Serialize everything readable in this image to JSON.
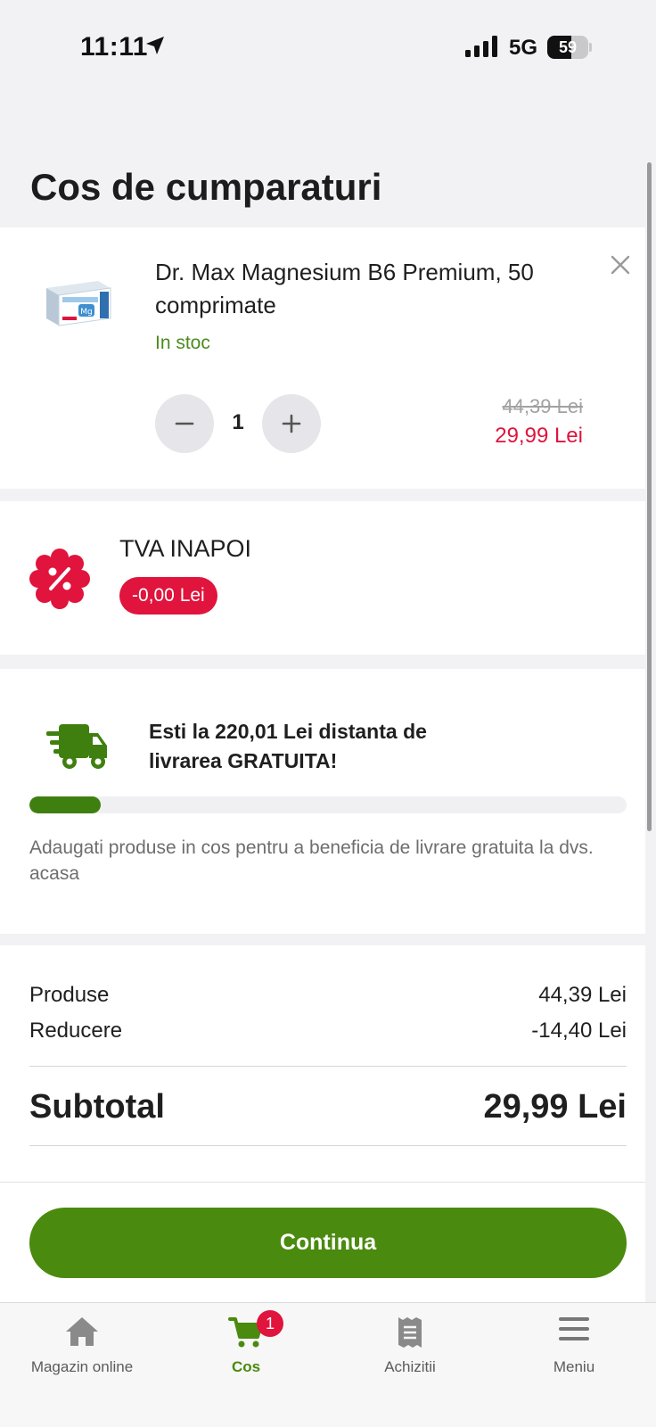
{
  "status_bar": {
    "time": "11:11",
    "network": "5G",
    "battery": "59",
    "battery_level": 0.59
  },
  "page": {
    "title": "Cos de cumparaturi"
  },
  "product": {
    "name": "Dr. Max Magnesium B6 Premium, 50 comprimate",
    "stock": "In stoc",
    "quantity": "1",
    "price_old": "44,39 Lei",
    "price_new": "29,99 Lei",
    "thumbnail_text": "Mg",
    "icons": {
      "remove": "close-icon",
      "minus": "minus-icon",
      "plus": "plus-icon"
    }
  },
  "tva": {
    "title": "TVA INAPOI",
    "amount": "-0,00 Lei",
    "icon": "percent-badge-icon"
  },
  "delivery": {
    "message": "Esti la 220,01 Lei distanta de livrarea GRATUITA!",
    "note": "Adaugati produse in cos pentru a beneficia de livrare gratuita la dvs. acasa",
    "progress": 0.12,
    "icon": "truck-icon"
  },
  "summary": {
    "products_label": "Produse",
    "products_value": "44,39 Lei",
    "discount_label": "Reducere",
    "discount_value": "-14,40 Lei",
    "subtotal_label": "Subtotal",
    "subtotal_value": "29,99 Lei"
  },
  "actions": {
    "continue_label": "Continua"
  },
  "tabs": [
    {
      "label": "Magazin online",
      "icon": "home-icon",
      "active": false
    },
    {
      "label": "Cos",
      "icon": "cart-icon",
      "active": true,
      "badge": "1"
    },
    {
      "label": "Achizitii",
      "icon": "receipt-icon",
      "active": false
    },
    {
      "label": "Meniu",
      "icon": "menu-icon",
      "active": false
    }
  ],
  "colors": {
    "brand_green": "#4a8a0e",
    "accent_red": "#e0143c",
    "stock_green": "#4a8c1c"
  }
}
